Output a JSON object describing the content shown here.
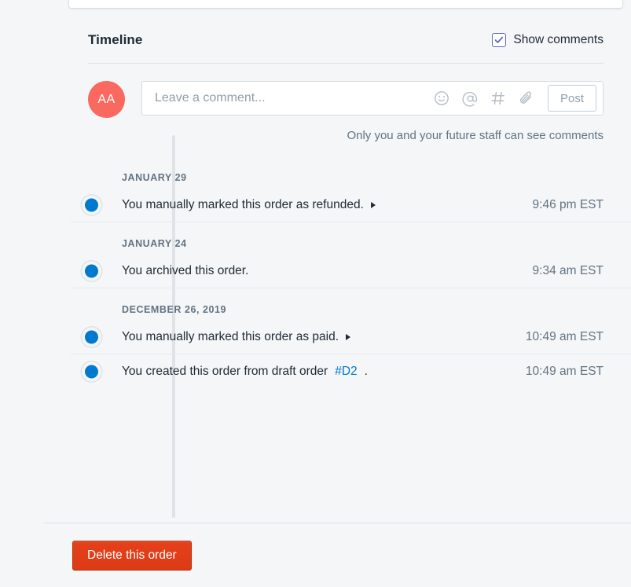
{
  "section": {
    "title": "Timeline",
    "show_comments_label": "Show comments",
    "checkbox_checked": true
  },
  "composer": {
    "avatar_initials": "AA",
    "placeholder": "Leave a comment...",
    "value": "",
    "post_label": "Post",
    "note": "Only you and your future staff can see comments",
    "icons": [
      "emoji-icon",
      "mention-icon",
      "hashtag-icon",
      "attachment-icon"
    ]
  },
  "timeline": {
    "groups": [
      {
        "date": "JANUARY 29",
        "events": [
          {
            "text": "You manually marked this order as refunded.",
            "has_disclosure": true,
            "time": "9:46 pm EST",
            "link": null,
            "link_suffix": null
          }
        ]
      },
      {
        "date": "JANUARY 24",
        "events": [
          {
            "text": "You archived this order.",
            "has_disclosure": false,
            "time": "9:34 am EST",
            "link": null,
            "link_suffix": null
          }
        ]
      },
      {
        "date": "DECEMBER 26, 2019",
        "events": [
          {
            "text": "You manually marked this order as paid.",
            "has_disclosure": true,
            "time": "10:49 am EST",
            "link": null,
            "link_suffix": null
          },
          {
            "text": "You created this order from draft order ",
            "has_disclosure": false,
            "time": "10:49 am EST",
            "link": "#D2",
            "link_suffix": "."
          }
        ]
      }
    ]
  },
  "footer": {
    "delete_label": "Delete this order"
  },
  "colors": {
    "accent_blue": "#007ace",
    "checkbox_indigo": "#5c6ac4",
    "avatar_red": "#f9695f",
    "danger_red": "#dc3b16",
    "page_bg": "#f4f6f8",
    "text_primary": "#212b36",
    "text_subdued": "#637381"
  }
}
